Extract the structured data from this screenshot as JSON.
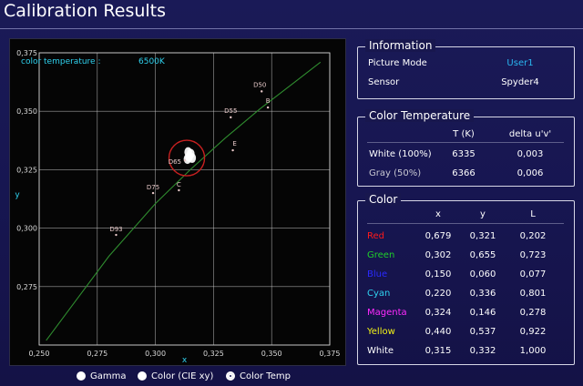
{
  "title": "Calibration Results",
  "chart": {
    "annotation_label": "color temperature :",
    "annotation_value": "6500K",
    "xlabel": "x",
    "ylabel": "y",
    "xticks": [
      "0,250",
      "0,275",
      "0,300",
      "0,325",
      "0,350",
      "0,375"
    ],
    "yticks": [
      "0,375",
      "0,350",
      "0,325",
      "0,300",
      "0,275"
    ],
    "point_labels": [
      "D50",
      "B",
      "D55",
      "E",
      "D65",
      "C",
      "D75",
      "D93"
    ]
  },
  "chart_data": {
    "type": "scatter",
    "xlabel": "x",
    "ylabel": "y",
    "xlim": [
      0.25,
      0.375
    ],
    "ylim": [
      0.25,
      0.375
    ],
    "grid": true,
    "annotation": "color temperature : 6500K",
    "reference_points": [
      {
        "label": "D50",
        "x": 0.3457,
        "y": 0.3585
      },
      {
        "label": "B",
        "x": 0.3484,
        "y": 0.3516
      },
      {
        "label": "D55",
        "x": 0.3324,
        "y": 0.3474
      },
      {
        "label": "E",
        "x": 0.3333,
        "y": 0.3333
      },
      {
        "label": "D65",
        "x": 0.3127,
        "y": 0.329
      },
      {
        "label": "C",
        "x": 0.3101,
        "y": 0.3162
      },
      {
        "label": "D75",
        "x": 0.299,
        "y": 0.315
      },
      {
        "label": "D93",
        "x": 0.2831,
        "y": 0.2971
      }
    ],
    "measured_points": [
      {
        "label": "White (100%)",
        "x": 0.3145,
        "y": 0.3305
      },
      {
        "label": "Gray (50%)",
        "x": 0.3138,
        "y": 0.3296
      },
      {
        "x": 0.3152,
        "y": 0.3318
      },
      {
        "x": 0.3141,
        "y": 0.3325
      },
      {
        "x": 0.3158,
        "y": 0.33
      }
    ],
    "blackbody_locus": [
      {
        "x": 0.253,
        "y": 0.252
      },
      {
        "x": 0.265,
        "y": 0.268
      },
      {
        "x": 0.28,
        "y": 0.288
      },
      {
        "x": 0.3,
        "y": 0.3105
      },
      {
        "x": 0.315,
        "y": 0.325
      },
      {
        "x": 0.33,
        "y": 0.3385
      },
      {
        "x": 0.345,
        "y": 0.351
      },
      {
        "x": 0.36,
        "y": 0.3625
      },
      {
        "x": 0.371,
        "y": 0.371
      }
    ],
    "target_circle": {
      "x": 0.3135,
      "y": 0.33
    }
  },
  "colors": {
    "accent_value": "#29b5ef",
    "chart_grid": "#d2d2d2",
    "locus": "#2f8c2f",
    "target_circle": "#c82020",
    "label_red": "#ff1a1a",
    "label_green": "#1fd12a",
    "label_blue": "#2a2aff",
    "label_cyan": "#2fd2ef",
    "label_magenta": "#ff2aff",
    "label_yellow": "#f3f317",
    "label_white": "#ffffff"
  },
  "information": {
    "title": "Information",
    "picture_mode_label": "Picture Mode",
    "picture_mode_value": "User1",
    "sensor_label": "Sensor",
    "sensor_value": "Spyder4"
  },
  "color_temperature": {
    "title": "Color Temperature",
    "headers": [
      "T (K)",
      "delta u'v'"
    ],
    "rows": [
      {
        "label": "White (100%)",
        "t": "6335",
        "delta": "0,003"
      },
      {
        "label": "Gray (50%)",
        "t": "6366",
        "delta": "0,006"
      }
    ]
  },
  "color_table": {
    "title": "Color",
    "headers": [
      "x",
      "y",
      "L"
    ],
    "rows": [
      {
        "label": "Red",
        "x": "0,679",
        "y": "0,321",
        "L": "0,202"
      },
      {
        "label": "Green",
        "x": "0,302",
        "y": "0,655",
        "L": "0,723"
      },
      {
        "label": "Blue",
        "x": "0,150",
        "y": "0,060",
        "L": "0,077"
      },
      {
        "label": "Cyan",
        "x": "0,220",
        "y": "0,336",
        "L": "0,801"
      },
      {
        "label": "Magenta",
        "x": "0,324",
        "y": "0,146",
        "L": "0,278"
      },
      {
        "label": "Yellow",
        "x": "0,440",
        "y": "0,537",
        "L": "0,922"
      },
      {
        "label": "White",
        "x": "0,315",
        "y": "0,332",
        "L": "1,000"
      }
    ]
  },
  "radios": {
    "gamma": "Gamma",
    "color_cie": "Color (CIE xy)",
    "color_temp": "Color Temp",
    "selected": "color_temp"
  }
}
